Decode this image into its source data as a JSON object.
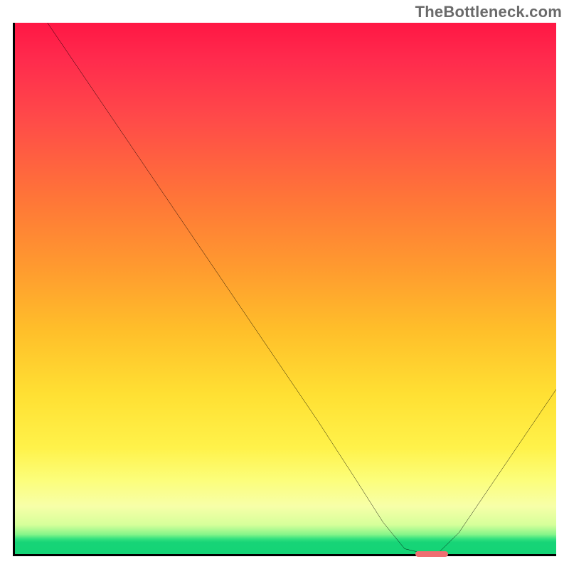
{
  "watermark": "TheBottleneck.com",
  "chart_data": {
    "type": "line",
    "title": "",
    "xlabel": "",
    "ylabel": "",
    "xlim": [
      0,
      100
    ],
    "ylim": [
      0,
      100
    ],
    "grid": false,
    "legend": false,
    "series": [
      {
        "name": "curve",
        "x": [
          6,
          14,
          22,
          24,
          32,
          40,
          48,
          56,
          63,
          68,
          72,
          76,
          78,
          82,
          88,
          94,
          100
        ],
        "y": [
          100,
          88,
          76,
          73,
          61,
          49,
          37,
          25,
          14,
          6,
          1,
          0,
          0,
          4,
          13,
          22,
          31
        ]
      }
    ],
    "minimum_marker_x_range": [
      74,
      80
    ],
    "minimum_marker_y": 0,
    "gradient_stops": [
      {
        "pos": 0,
        "color": "#ff1744"
      },
      {
        "pos": 46,
        "color": "#ff9a2f"
      },
      {
        "pos": 80,
        "color": "#fff24a"
      },
      {
        "pos": 97,
        "color": "#2fe07e"
      },
      {
        "pos": 100,
        "color": "#14d476"
      }
    ],
    "annotations": []
  }
}
